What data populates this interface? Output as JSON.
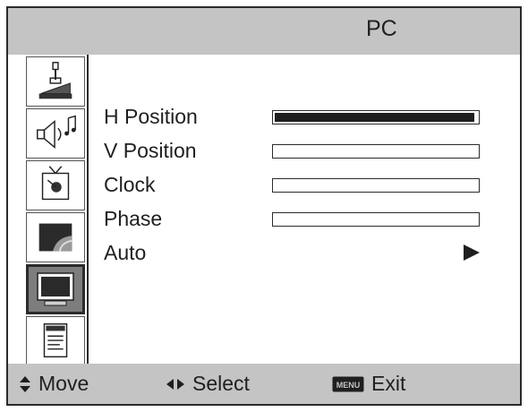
{
  "window": {
    "title": "PC"
  },
  "sidebar": {
    "items": [
      {
        "name": "picture",
        "icon": "picture-icon",
        "active": false
      },
      {
        "name": "sound",
        "icon": "sound-icon",
        "active": false
      },
      {
        "name": "channel",
        "icon": "antenna-tv-icon",
        "active": false
      },
      {
        "name": "function",
        "icon": "screen-function-icon",
        "active": false
      },
      {
        "name": "pc",
        "icon": "monitor-icon",
        "active": true
      },
      {
        "name": "lock",
        "icon": "document-icon",
        "active": false
      }
    ]
  },
  "menu": {
    "items": [
      {
        "label": "H Position",
        "control": "slider",
        "level": 1.0
      },
      {
        "label": "V Position",
        "control": "slider",
        "level": 0.0
      },
      {
        "label": "Clock",
        "control": "slider",
        "level": 0.0
      },
      {
        "label": "Phase",
        "control": "slider",
        "level": 0.0
      },
      {
        "label": "Auto",
        "control": "submenu-arrow"
      }
    ]
  },
  "footer": {
    "move_label": "Move",
    "select_label": "Select",
    "menu_badge": "MENU",
    "exit_label": "Exit"
  },
  "colors": {
    "panel_gray": "#c4c4c4",
    "active_gray": "#7d7d7d",
    "ink": "#1f1f1f"
  }
}
